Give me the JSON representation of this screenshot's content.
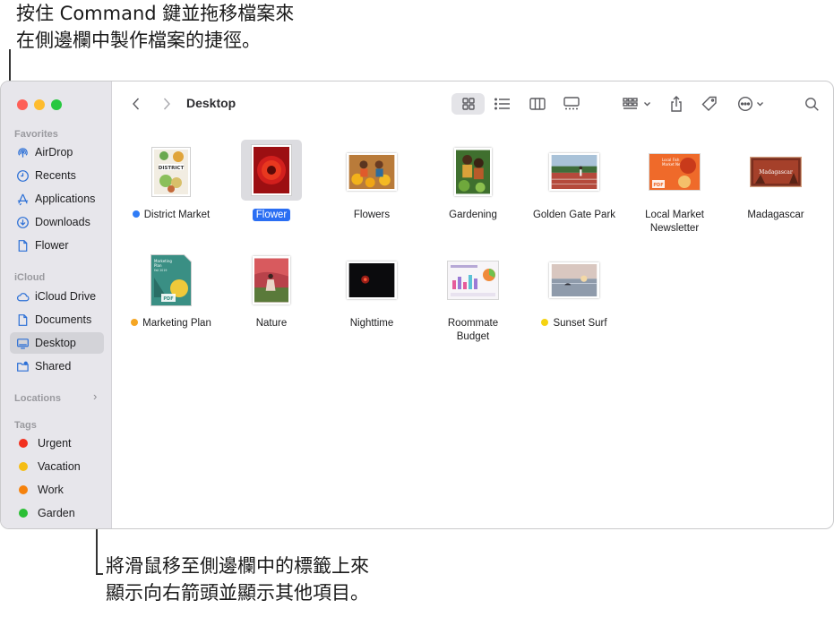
{
  "callouts": {
    "top": "按住 Command 鍵並拖移檔案來\n在側邊欄中製作檔案的捷徑。",
    "bottom": "將滑鼠移至側邊欄中的標籤上來\n顯示向右箭頭並顯示其他項目。"
  },
  "window": {
    "title": "Desktop"
  },
  "sidebar": {
    "favorites_header": "Favorites",
    "favorites": [
      {
        "label": "AirDrop",
        "icon": "airdrop-icon"
      },
      {
        "label": "Recents",
        "icon": "clock-icon"
      },
      {
        "label": "Applications",
        "icon": "applications-icon"
      },
      {
        "label": "Downloads",
        "icon": "download-icon"
      },
      {
        "label": "Flower",
        "icon": "document-icon"
      }
    ],
    "icloud_header": "iCloud",
    "icloud": [
      {
        "label": "iCloud Drive",
        "icon": "cloud-icon"
      },
      {
        "label": "Documents",
        "icon": "document-icon"
      },
      {
        "label": "Desktop",
        "icon": "desktop-icon",
        "selected": true
      },
      {
        "label": "Shared",
        "icon": "shared-folder-icon"
      }
    ],
    "locations_header": "Locations",
    "tags_header": "Tags",
    "tags": [
      {
        "label": "Urgent",
        "color": "#f2301e"
      },
      {
        "label": "Vacation",
        "color": "#f5bd14"
      },
      {
        "label": "Work",
        "color": "#f5820d"
      },
      {
        "label": "Garden",
        "color": "#2bbf35"
      }
    ]
  },
  "files": [
    {
      "name": "District Market",
      "tag_color": "#2f7cf6"
    },
    {
      "name": "Flower",
      "selected": true
    },
    {
      "name": "Flowers"
    },
    {
      "name": "Gardening"
    },
    {
      "name": "Golden Gate Park"
    },
    {
      "name": "Local Market\nNewsletter"
    },
    {
      "name": "Madagascar"
    },
    {
      "name": "Marketing Plan",
      "tag_color": "#f5a623"
    },
    {
      "name": "Nature"
    },
    {
      "name": "Nighttime"
    },
    {
      "name": "Roommate\nBudget"
    },
    {
      "name": "Sunset Surf",
      "tag_color": "#f5d312"
    }
  ],
  "thumb_text": {
    "district": "DISTRICT",
    "pdf": "PDF",
    "madagascar": "Madagascar",
    "marketing": "Marketing\nPlan\nFall 2019",
    "newsletter": "Local Fish\nMarket News"
  }
}
